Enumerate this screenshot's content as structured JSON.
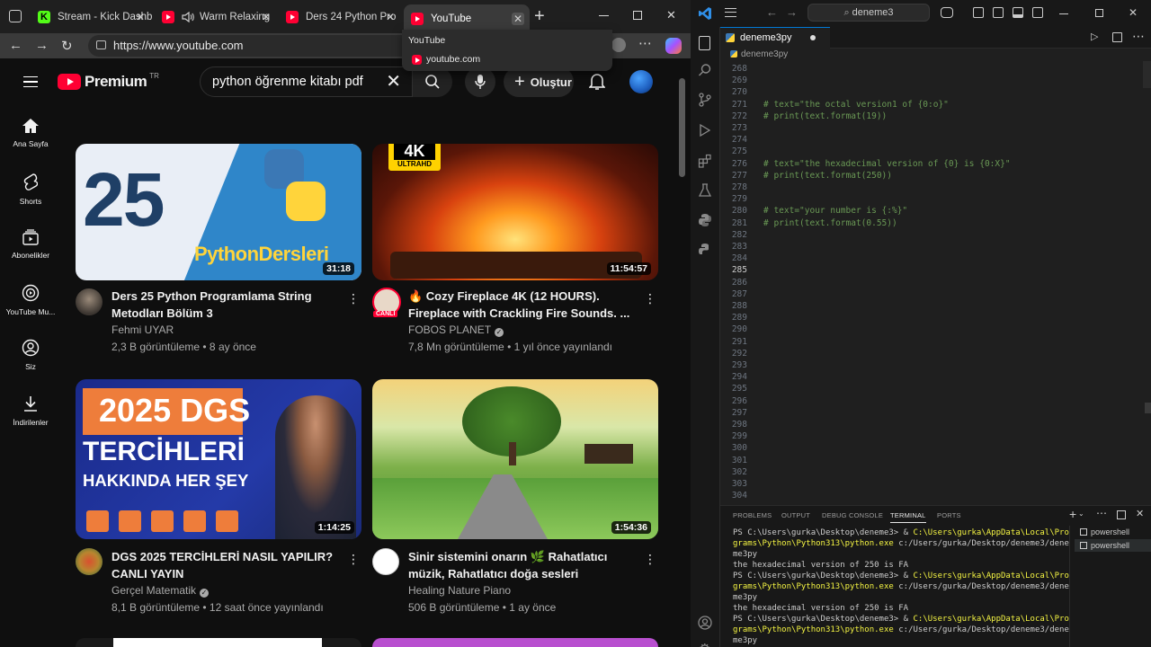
{
  "browser": {
    "tabs": [
      {
        "title": "Stream - Kick Dashbo",
        "favicon": "kick-icon"
      },
      {
        "title": "Warm Relaxing",
        "favicon": "youtube-icon",
        "audio": true
      },
      {
        "title": "Ders 24 Python Pro",
        "favicon": "youtube-icon"
      },
      {
        "title": "YouTube",
        "favicon": "youtube-icon",
        "active": true
      }
    ],
    "url": "https://www.youtube.com",
    "tooltip": {
      "title": "YouTube",
      "domain": "youtube.com"
    }
  },
  "youtube": {
    "logo_text": "Premium",
    "region": "TR",
    "search_query": "python öğrenme kitabı pdf",
    "create_label": "Oluştur",
    "nav": [
      "Ana Sayfa",
      "Shorts",
      "Abonelikler",
      "YouTube Mu...",
      "Siz",
      "İndirilenler"
    ],
    "videos": [
      {
        "title": "Ders 25 Python Programlama String Metodları Bölüm 3",
        "channel": "Fehmi UYAR",
        "verified": false,
        "meta": "2,3 B görüntüleme • 8 ay önce",
        "duration": "31:18",
        "thumb_number": "25",
        "thumb_text": "PythonDersleri"
      },
      {
        "title": "🔥 Cozy Fireplace 4K (12 HOURS). Fireplace with Crackling Fire Sounds. ...",
        "channel": "FOBOS PLANET",
        "verified": true,
        "meta": "7,8 Mn görüntüleme • 1 yıl önce yayınlandı",
        "duration": "11:54:57",
        "thumb_badge_top": "4K",
        "thumb_badge_bottom": "ULTRAHD",
        "live_badge": "CANLI"
      },
      {
        "title": "DGS 2025 TERCİHLERİ NASIL YAPILIR? CANLI YAYIN",
        "channel": "Gerçel Matematik",
        "verified": true,
        "meta": "8,1 B görüntüleme • 12 saat önce yayınlandı",
        "duration": "1:14:25",
        "thumb_line1": "2025 DGS",
        "thumb_line2": "TERCİHLERİ",
        "thumb_line3": "HAKKINDA HER ŞEY"
      },
      {
        "title": "Sinir sistemini onarın 🌿 Rahatlatıcı müzik, Rahatlatıcı doğa sesleri",
        "channel": "Healing Nature Piano",
        "verified": false,
        "meta": "506 B görüntüleme • 1 ay önce",
        "duration": "1:54:36"
      }
    ]
  },
  "vscode": {
    "search": "deneme3",
    "tab": "deneme3py",
    "breadcrumb": "deneme3py",
    "lines": [
      {
        "n": "268",
        "code": ""
      },
      {
        "n": "269",
        "code": ""
      },
      {
        "n": "270",
        "code": ""
      },
      {
        "n": "271",
        "code": "# text=\"the octal version1 of {0:o}\""
      },
      {
        "n": "272",
        "code": "# print(text.format(19))"
      },
      {
        "n": "273",
        "code": ""
      },
      {
        "n": "274",
        "code": ""
      },
      {
        "n": "275",
        "code": ""
      },
      {
        "n": "276",
        "code": "# text=\"the hexadecimal version of {0} is {0:X}\""
      },
      {
        "n": "277",
        "code": "# print(text.format(250))"
      },
      {
        "n": "278",
        "code": ""
      },
      {
        "n": "279",
        "code": ""
      },
      {
        "n": "280",
        "code": "# text=\"your number is {:%}\""
      },
      {
        "n": "281",
        "code": "# print(text.format(0.55))"
      },
      {
        "n": "282",
        "code": ""
      },
      {
        "n": "283",
        "code": ""
      },
      {
        "n": "284",
        "code": ""
      },
      {
        "n": "285",
        "code": ""
      },
      {
        "n": "286",
        "code": ""
      },
      {
        "n": "287",
        "code": ""
      },
      {
        "n": "288",
        "code": ""
      },
      {
        "n": "289",
        "code": ""
      },
      {
        "n": "290",
        "code": ""
      },
      {
        "n": "291",
        "code": ""
      },
      {
        "n": "292",
        "code": ""
      },
      {
        "n": "293",
        "code": ""
      },
      {
        "n": "294",
        "code": ""
      },
      {
        "n": "295",
        "code": ""
      },
      {
        "n": "296",
        "code": ""
      },
      {
        "n": "297",
        "code": ""
      },
      {
        "n": "298",
        "code": ""
      },
      {
        "n": "299",
        "code": ""
      },
      {
        "n": "300",
        "code": ""
      },
      {
        "n": "301",
        "code": ""
      },
      {
        "n": "302",
        "code": ""
      },
      {
        "n": "303",
        "code": ""
      },
      {
        "n": "304",
        "code": ""
      }
    ],
    "current_line": "285",
    "panel_tabs": [
      "PROBLEMS",
      "OUTPUT",
      "DEBUG CONSOLE",
      "TERMINAL",
      "PORTS"
    ],
    "active_panel_tab": "TERMINAL",
    "terminal": [
      {
        "prompt": "PS C:\\Users\\gurka\\Desktop\\deneme3> & ",
        "path": "C:\\Users\\gurka\\AppData\\Local\\Pro"
      },
      {
        "text": "",
        "path": "grams\\Python\\Python313\\python.exe",
        "rest": " c:/Users/gurka/Desktop/deneme3/dene"
      },
      {
        "text": "me3py"
      },
      {
        "text": "the hexadecimal version of 250 is FA"
      },
      {
        "prompt": "PS C:\\Users\\gurka\\Desktop\\deneme3> & ",
        "path": "C:\\Users\\gurka\\AppData\\Local\\Pro"
      },
      {
        "text": "",
        "path": "grams\\Python\\Python313\\python.exe",
        "rest": " c:/Users/gurka/Desktop/deneme3/dene"
      },
      {
        "text": "me3py"
      },
      {
        "text": "the hexadecimal version of 250 is FA"
      },
      {
        "prompt": "PS C:\\Users\\gurka\\Desktop\\deneme3> & ",
        "path": "C:\\Users\\gurka\\AppData\\Local\\Pro"
      },
      {
        "text": "",
        "path": "grams\\Python\\Python313\\python.exe",
        "rest": " c:/Users/gurka/Desktop/deneme3/dene"
      },
      {
        "text": "me3py"
      }
    ],
    "terminal_list": [
      "powershell",
      "powershell"
    ]
  }
}
